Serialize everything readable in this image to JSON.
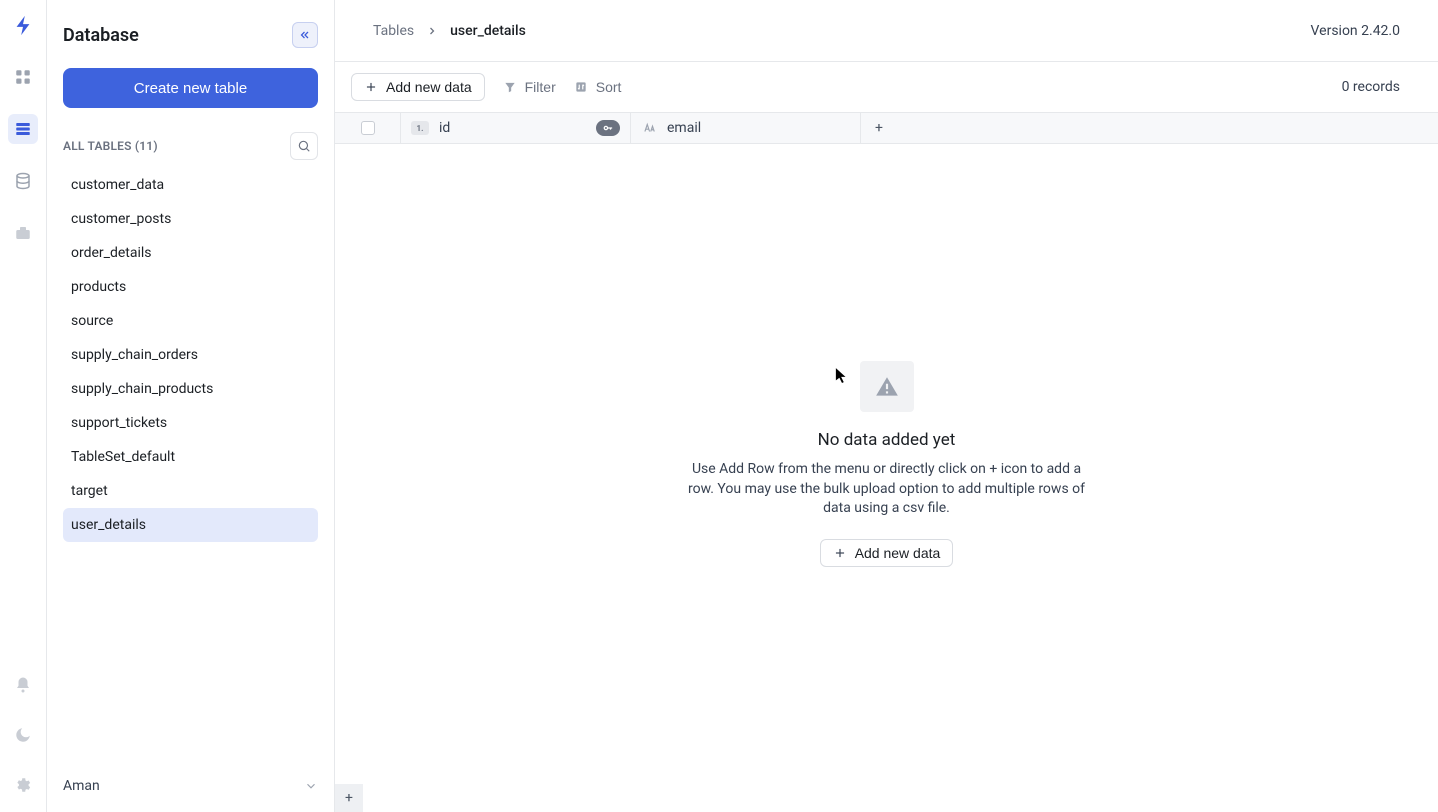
{
  "sidebar": {
    "title": "Database",
    "create_label": "Create new table",
    "all_tables_label": "ALL TABLES (11)",
    "items": [
      {
        "label": "customer_data"
      },
      {
        "label": "customer_posts"
      },
      {
        "label": "order_details"
      },
      {
        "label": "products"
      },
      {
        "label": "source"
      },
      {
        "label": "supply_chain_orders"
      },
      {
        "label": "supply_chain_products"
      },
      {
        "label": "support_tickets"
      },
      {
        "label": "TableSet_default"
      },
      {
        "label": "target"
      },
      {
        "label": "user_details"
      }
    ],
    "active_index": 10,
    "user_label": "Aman"
  },
  "breadcrumb": {
    "root": "Tables",
    "current": "user_details"
  },
  "version": "Version 2.42.0",
  "toolbar": {
    "add_label": "Add new data",
    "filter_label": "Filter",
    "sort_label": "Sort",
    "records_label": "0 records"
  },
  "columns": {
    "id_label": "id",
    "email_label": "email",
    "add_label": "+"
  },
  "empty": {
    "title": "No data added yet",
    "subtitle": "Use Add Row from the menu or directly click on + icon to add a row. You may use the bulk upload option to add multiple rows of data using a csv file.",
    "button": "Add new data"
  },
  "fab": {
    "plus": "+"
  }
}
